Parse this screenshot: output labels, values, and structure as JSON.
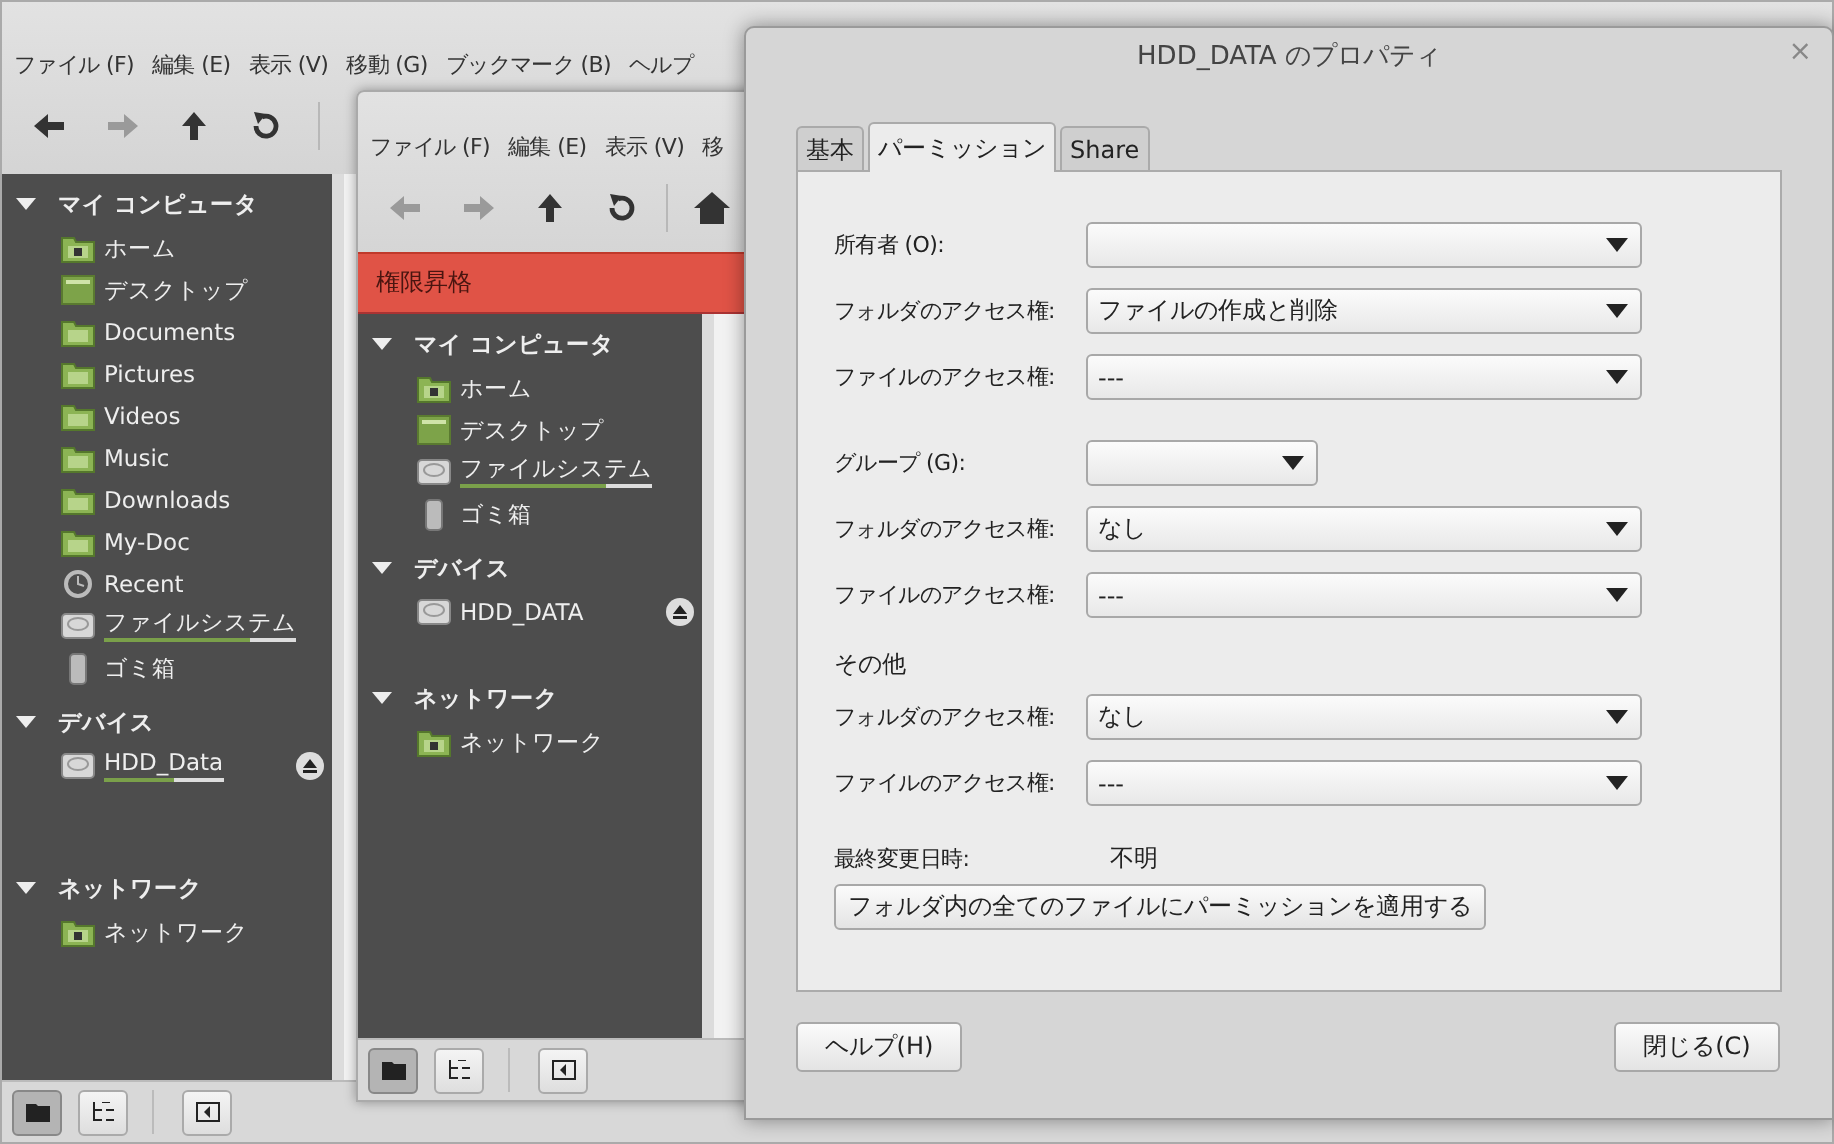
{
  "file_windows": [
    {
      "menu": [
        "ファイル (F)",
        "編集 (E)",
        "表示 (V)",
        "移動 (G)",
        "ブックマーク (B)",
        "ヘルプ"
      ],
      "toolbar": [
        {
          "kind": "back",
          "disabled": false
        },
        {
          "kind": "forward",
          "disabled": true
        },
        {
          "kind": "up",
          "disabled": false
        },
        {
          "kind": "reload",
          "disabled": false
        }
      ],
      "sidebar": [
        {
          "title": "マイ コンピュータ",
          "expanded": true,
          "items": [
            {
              "kind": "home",
              "label": "ホーム"
            },
            {
              "kind": "desktop",
              "label": "デスクトップ"
            },
            {
              "kind": "folder",
              "label": "Documents"
            },
            {
              "kind": "folder",
              "label": "Pictures"
            },
            {
              "kind": "folder",
              "label": "Videos"
            },
            {
              "kind": "folder",
              "label": "Music"
            },
            {
              "kind": "folder",
              "label": "Downloads"
            },
            {
              "kind": "folder",
              "label": "My-Doc"
            },
            {
              "kind": "recent",
              "label": "Recent"
            },
            {
              "kind": "drive",
              "label": "ファイルシステム",
              "level": 0.76
            },
            {
              "kind": "trash",
              "label": "ゴミ箱"
            }
          ]
        },
        {
          "title": "デバイス",
          "expanded": true,
          "items": [
            {
              "kind": "drive",
              "label": "HDD_Data",
              "level": 0.59,
              "eject": true
            }
          ]
        },
        {
          "title": "ネットワーク",
          "expanded": true,
          "items": [
            {
              "kind": "network",
              "label": "ネットワーク"
            }
          ]
        }
      ],
      "bottom_buttons": [
        {
          "kind": "places",
          "selected": true
        },
        {
          "kind": "tree",
          "selected": false
        },
        {
          "kind": "toggle",
          "selected": false
        }
      ]
    },
    {
      "menu": [
        "ファイル (F)",
        "編集 (E)",
        "表示 (V)",
        "移"
      ],
      "toolbar": [
        {
          "kind": "back",
          "disabled": true
        },
        {
          "kind": "forward",
          "disabled": true
        },
        {
          "kind": "up",
          "disabled": false
        },
        {
          "kind": "reload",
          "disabled": false
        },
        {
          "kind": "home",
          "disabled": false
        }
      ],
      "banner": "権限昇格",
      "sidebar": [
        {
          "title": "マイ コンピュータ",
          "expanded": true,
          "items": [
            {
              "kind": "home",
              "label": "ホーム"
            },
            {
              "kind": "desktop",
              "label": "デスクトップ"
            },
            {
              "kind": "drive",
              "label": "ファイルシステム",
              "level": 0.76
            },
            {
              "kind": "trash",
              "label": "ゴミ箱"
            }
          ]
        },
        {
          "title": "デバイス",
          "expanded": true,
          "items": [
            {
              "kind": "drive",
              "label": "HDD_DATA",
              "eject": true
            }
          ]
        },
        {
          "title": "ネットワーク",
          "expanded": true,
          "items": [
            {
              "kind": "network",
              "label": "ネットワーク"
            }
          ]
        }
      ],
      "bottom_buttons": [
        {
          "kind": "places",
          "selected": true
        },
        {
          "kind": "tree",
          "selected": false
        },
        {
          "kind": "toggle",
          "selected": false
        }
      ]
    }
  ],
  "dialog": {
    "title": "HDD_DATA のプロパティ",
    "close": "×",
    "tabs": [
      {
        "label": "基本",
        "selected": false
      },
      {
        "label": "パーミッション",
        "selected": true
      },
      {
        "label": "Share",
        "selected": false
      }
    ],
    "sections": [
      {
        "rows": [
          {
            "label": "所有者 (O):",
            "kind": "select",
            "value": ""
          },
          {
            "label": "フォルダのアクセス権:",
            "kind": "select",
            "value": "ファイルの作成と削除"
          },
          {
            "label": "ファイルのアクセス権:",
            "kind": "select",
            "value": "---"
          }
        ]
      },
      {
        "rows": [
          {
            "label": "グループ (G):",
            "kind": "short-select",
            "value": ""
          },
          {
            "label": "フォルダのアクセス権:",
            "kind": "select",
            "value": "なし"
          },
          {
            "label": "ファイルのアクセス権:",
            "kind": "select",
            "value": "---"
          }
        ]
      },
      {
        "heading": "その他",
        "rows": [
          {
            "label": "フォルダのアクセス権:",
            "kind": "select",
            "value": "なし"
          },
          {
            "label": "ファイルのアクセス権:",
            "kind": "select",
            "value": "---"
          }
        ]
      }
    ],
    "modified": {
      "label": "最終変更日時:",
      "value": "不明"
    },
    "apply_button": "フォルダ内の全てのファイルにパーミッションを適用する",
    "buttons": [
      "ヘルプ(H)",
      "閉じる(C)"
    ]
  }
}
